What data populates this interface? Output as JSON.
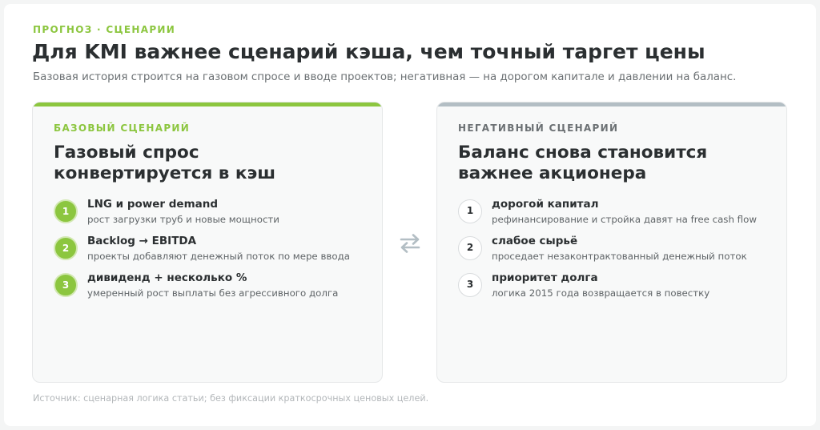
{
  "header": {
    "eyebrow": "ПРОГНОЗ · СЦЕНАРИИ",
    "title": "Для KMI важнее сценарий кэша, чем точный таргет цены",
    "subtitle": "Базовая история строится на газовом спросе и вводе проектов; негативная — на дорогом капитале и давлении на баланс."
  },
  "colors": {
    "accent_green": "#8cc63f",
    "neutral_gray": "#b3bec4",
    "text_dark": "#2b2f31"
  },
  "base": {
    "label": "БАЗОВЫЙ СЦЕНАРИЙ",
    "heading_line1": "Газовый спрос",
    "heading_line2": "конвертируется в кэш",
    "items": [
      {
        "num": "1",
        "title": "LNG и power demand",
        "desc": "рост загрузки труб и новые мощности"
      },
      {
        "num": "2",
        "title": "Backlog → EBITDA",
        "desc": "проекты добавляют денежный поток по мере ввода"
      },
      {
        "num": "3",
        "title": "дивиденд + несколько %",
        "desc": "умеренный рост выплаты без агрессивного долга"
      }
    ]
  },
  "swap_icon": "swap-arrows-icon",
  "negative": {
    "label": "НЕГАТИВНЫЙ СЦЕНАРИЙ",
    "heading_line1": "Баланс снова становится",
    "heading_line2": "важнее акционера",
    "items": [
      {
        "num": "1",
        "title": "дорогой капитал",
        "desc": "рефинансирование и стройка давят на free cash flow"
      },
      {
        "num": "2",
        "title": "слабое сырьё",
        "desc": "проседает незаконтрактованный денежный поток"
      },
      {
        "num": "3",
        "title": "приоритет долга",
        "desc": "логика 2015 года возвращается в повестку"
      }
    ]
  },
  "footer": {
    "source": "Источник: сценарная логика статьи; без фиксации краткосрочных ценовых целей."
  }
}
